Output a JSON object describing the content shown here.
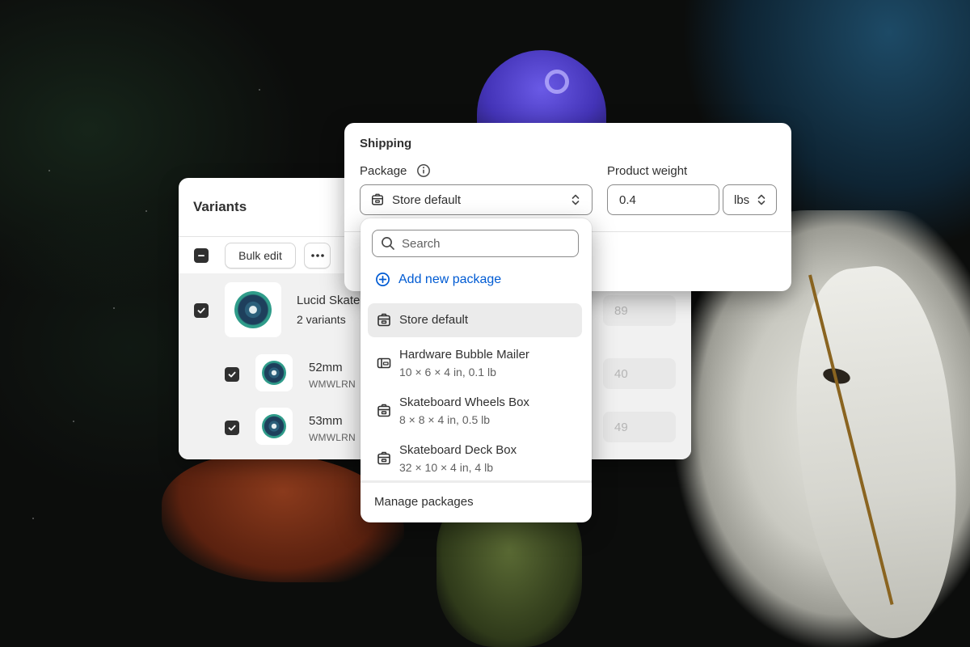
{
  "variants": {
    "title": "Variants",
    "toolbar": {
      "bulk_edit_label": "Bulk edit",
      "more_icon": "more-horizontal-icon"
    },
    "product": {
      "name": "Lucid Skate",
      "sub": "2 variants",
      "qty": "89"
    },
    "rows": [
      {
        "name": "52mm",
        "sku": "WMWLRN",
        "qty": "40"
      },
      {
        "name": "53mm",
        "sku": "WMWLRN",
        "qty": "49"
      }
    ]
  },
  "shipping": {
    "title": "Shipping",
    "package_label": "Package",
    "package_selected": "Store default",
    "weight_label": "Product weight",
    "weight_value": "0.4",
    "weight_unit": "lbs"
  },
  "dropdown": {
    "search_placeholder": "Search",
    "add_new_label": "Add new package",
    "options": [
      {
        "name": "Store default",
        "dims": "",
        "icon": "box-icon",
        "selected": true
      },
      {
        "name": "Hardware Bubble Mailer",
        "dims": "10 × 6 × 4 in, 0.1 lb",
        "icon": "mailer-icon"
      },
      {
        "name": "Skateboard Wheels Box",
        "dims": "8 × 8 × 4 in, 0.5 lb",
        "icon": "box-icon"
      },
      {
        "name": "Skateboard Deck Box",
        "dims": "32 × 10 × 4 in, 4 lb",
        "icon": "box-icon"
      }
    ],
    "manage_label": "Manage packages"
  },
  "colors": {
    "accent_link": "#005bd3",
    "checkbox": "#303030",
    "selected_bg": "#ebebeb"
  }
}
